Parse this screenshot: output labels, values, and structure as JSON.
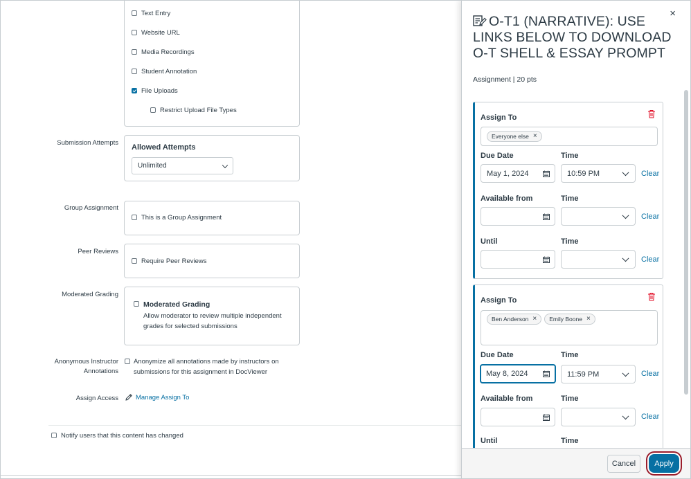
{
  "main": {
    "submission_types": [
      {
        "label": "Text Entry",
        "checked": false
      },
      {
        "label": "Website URL",
        "checked": false
      },
      {
        "label": "Media Recordings",
        "checked": false
      },
      {
        "label": "Student Annotation",
        "checked": false
      },
      {
        "label": "File Uploads",
        "checked": true
      }
    ],
    "restrict_upload": {
      "label": "Restrict Upload File Types",
      "checked": false
    },
    "submission_attempts": {
      "row_label": "Submission Attempts",
      "heading": "Allowed Attempts",
      "selected": "Unlimited"
    },
    "group_assignment": {
      "row_label": "Group Assignment",
      "option": "This is a Group Assignment",
      "checked": false
    },
    "peer_reviews": {
      "row_label": "Peer Reviews",
      "option": "Require Peer Reviews",
      "checked": false
    },
    "moderated_grading": {
      "row_label": "Moderated Grading",
      "option": "Moderated Grading",
      "description": "Allow moderator to review multiple independent grades for selected submissions",
      "checked": false
    },
    "anonymous": {
      "row_label_1": "Anonymous Instructor",
      "row_label_2": "Annotations",
      "option": "Anonymize all annotations made by instructors on submissions for this assignment in DocViewer",
      "checked": false
    },
    "assign_access": {
      "row_label": "Assign Access",
      "link": "Manage Assign To",
      "icon": "pencil-icon"
    },
    "notify": {
      "label": "Notify users that this content has changed",
      "checked": false
    }
  },
  "tray": {
    "title": "O-T1 (NARRATIVE): USE LINKS BELOW TO DOWNLOAD O-T SHELL & ESSAY PROMPT",
    "title_icon": "assignment-icon",
    "subtitle": "Assignment | 20 pts",
    "close_label": "×",
    "cards": [
      {
        "assign_to_label": "Assign To",
        "assignees": [
          "Everyone else"
        ],
        "due_date_label": "Due Date",
        "due_date": "May 1, 2024",
        "time_label": "Time",
        "due_time": "10:59 PM",
        "available_from_label": "Available from",
        "available_from": "",
        "available_time": "",
        "until_label": "Until",
        "until": "",
        "until_time": "",
        "clear_label": "Clear"
      },
      {
        "assign_to_label": "Assign To",
        "assignees": [
          "Ben Anderson",
          "Emily Boone"
        ],
        "due_date_label": "Due Date",
        "due_date": "May 8, 2024",
        "time_label": "Time",
        "due_time": "11:59 PM",
        "available_from_label": "Available from",
        "available_from": "",
        "available_time": "",
        "until_label": "Until",
        "clear_label": "Clear"
      }
    ],
    "footer": {
      "cancel": "Cancel",
      "apply": "Apply"
    },
    "colors": {
      "accent": "#0770a3",
      "danger": "#e0061f",
      "focus_ring": "#9a1d2b"
    }
  }
}
